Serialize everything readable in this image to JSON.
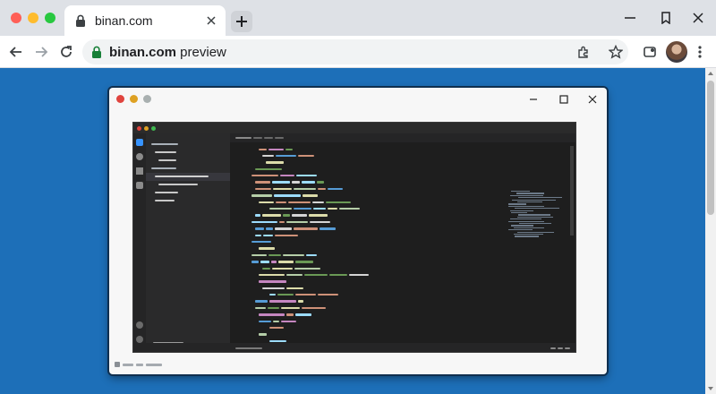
{
  "browser": {
    "tab_title": "binan.com",
    "url_domain": "binan.com",
    "url_rest": " preview"
  },
  "colors": {
    "page_background": "#1d6fb8",
    "editor_background": "#1e1e1e",
    "tabstrip": "#dee1e6"
  },
  "icons": {
    "tab": [
      "lock-icon",
      "close-icon"
    ],
    "toolbar": [
      "back-arrow-icon",
      "forward-arrow-icon",
      "reload-icon",
      "lock-icon",
      "extension-icon",
      "star-icon",
      "cast-icon",
      "avatar",
      "kebab-menu-icon"
    ],
    "window": [
      "minimize-icon",
      "restore-icon",
      "close-icon"
    ]
  }
}
